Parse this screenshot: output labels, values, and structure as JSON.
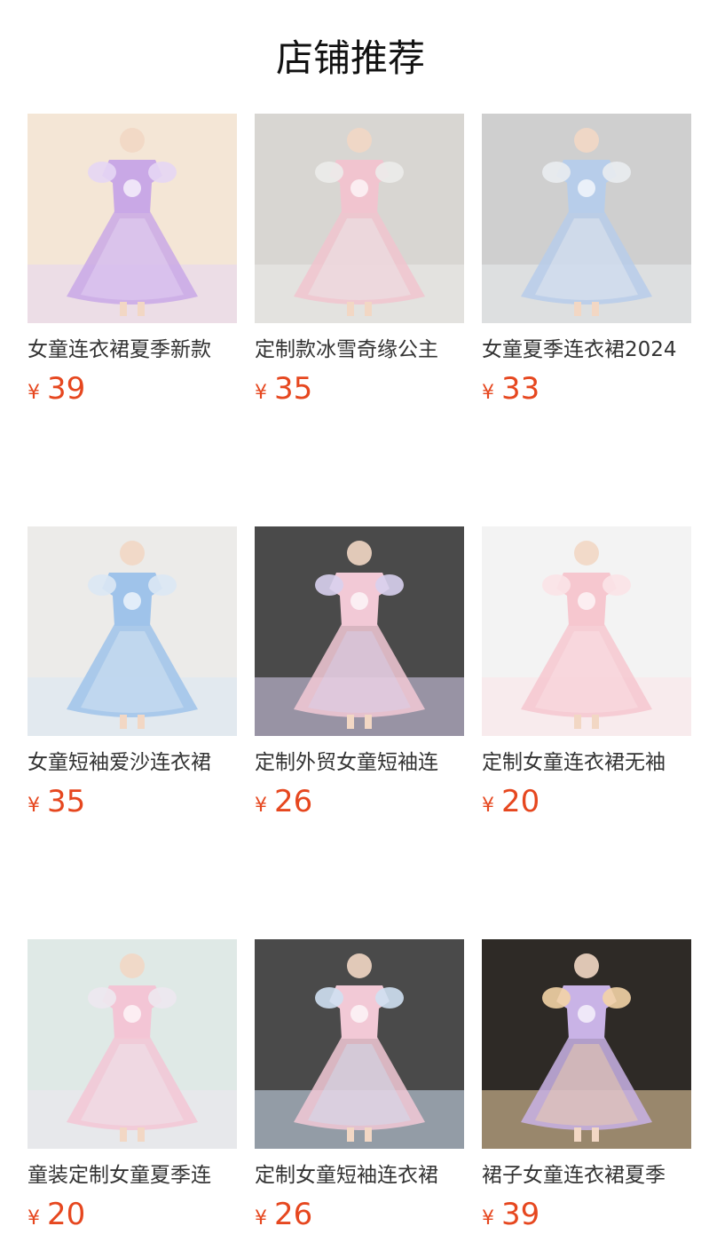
{
  "section": {
    "title": "店铺推荐"
  },
  "currency_symbol": "¥",
  "accent_color": "#e6471f",
  "products": [
    {
      "name": "女童连衣裙夏季新款",
      "price": "39",
      "thumb_colors": [
        "#f4e6d6",
        "#c9a8e6",
        "#e6d6f4"
      ]
    },
    {
      "name": "定制款冰雪奇缘公主",
      "price": "35",
      "thumb_colors": [
        "#d8d6d2",
        "#f1c4cf",
        "#ececea"
      ]
    },
    {
      "name": "女童夏季连衣裙2024",
      "price": "33",
      "thumb_colors": [
        "#cfcfcf",
        "#b7cdea",
        "#e9ecef"
      ]
    },
    {
      "name": "女童短袖爱沙连衣裙",
      "price": "35",
      "thumb_colors": [
        "#ecebe9",
        "#9fc3ea",
        "#dbe8f4"
      ]
    },
    {
      "name": "定制外贸女童短袖连",
      "price": "26",
      "thumb_colors": [
        "#4a4a4a",
        "#f2c9d6",
        "#d8d0ee"
      ]
    },
    {
      "name": "定制女童连衣裙无袖",
      "price": "20",
      "thumb_colors": [
        "#f3f3f3",
        "#f6c7cf",
        "#fbe3e7"
      ]
    },
    {
      "name": "童装定制女童夏季连",
      "price": "20",
      "thumb_colors": [
        "#dfe9e6",
        "#f3c5d5",
        "#ede8ef"
      ]
    },
    {
      "name": "定制女童短袖连衣裙",
      "price": "26",
      "thumb_colors": [
        "#4a4a4a",
        "#f2c9d6",
        "#cfe0f2"
      ]
    },
    {
      "name": "裙子女童连衣裙夏季",
      "price": "39",
      "thumb_colors": [
        "#2e2a26",
        "#c9b3e6",
        "#f3d3a6"
      ]
    }
  ]
}
